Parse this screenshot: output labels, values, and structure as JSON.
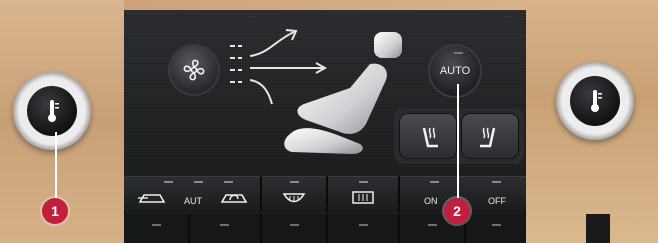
{
  "controls": {
    "auto_label": "AUTO",
    "aut_label": "AUT",
    "on_label": "ON",
    "off_label": "OFF"
  },
  "callouts": {
    "one": "1",
    "two": "2"
  },
  "icons": {
    "fan": "fan-icon",
    "seat": "seat-icon",
    "thermometer": "thermometer-icon",
    "seat_heater": "seat-heater-icon",
    "recirculation": "recirculation-icon",
    "defrost_front": "defrost-front-icon",
    "defrost_rear": "defrost-rear-icon"
  },
  "colors": {
    "callout_red": "#c0203c",
    "cold_blue": "#2a4cd6",
    "hot_red": "#d8282a",
    "panel_black": "#1c1d1f"
  }
}
